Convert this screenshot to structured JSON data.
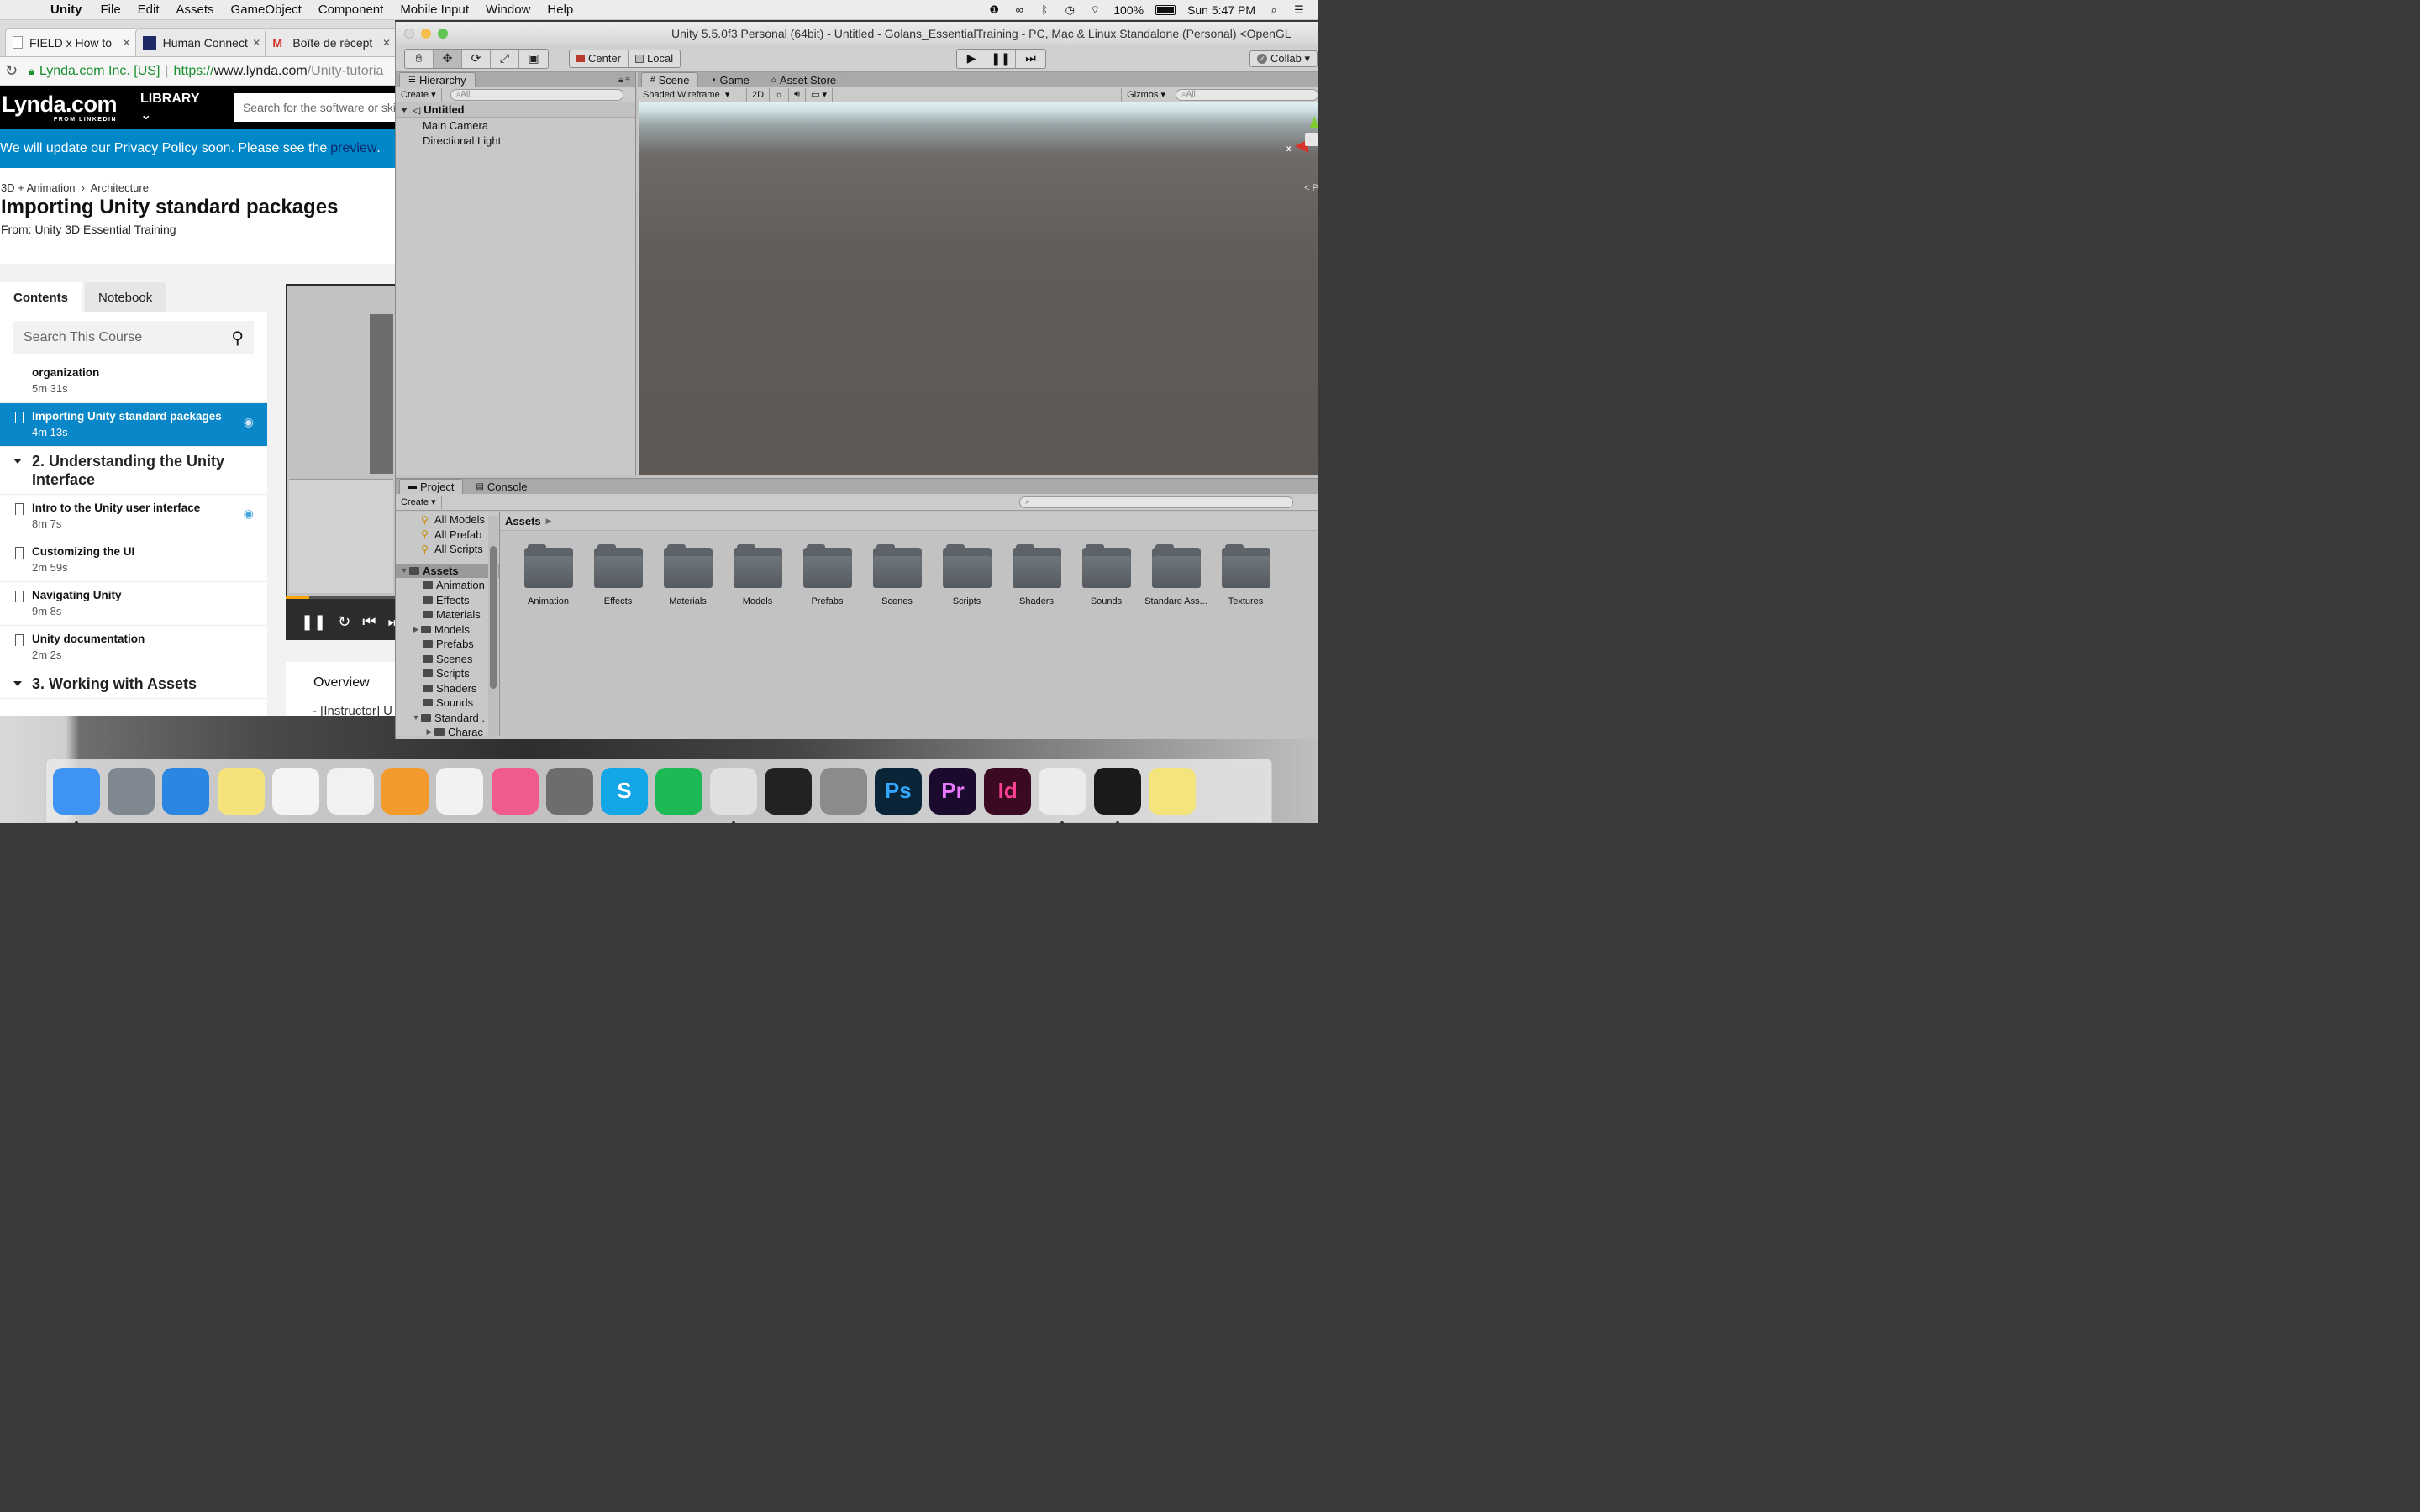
{
  "menubar": {
    "app_name": "Unity",
    "items": [
      "File",
      "Edit",
      "Assets",
      "GameObject",
      "Component",
      "Mobile Input",
      "Window",
      "Help"
    ],
    "battery": "100%",
    "clock": "Sun 5:47 PM",
    "status_icons": [
      "notification-icon",
      "creative-cloud-icon",
      "bluetooth-icon",
      "time-machine-icon",
      "wifi-icon",
      "battery-icon",
      "spotlight-icon",
      "notification-center-icon"
    ]
  },
  "chrome": {
    "tabs": [
      {
        "title": "FIELD x How to"
      },
      {
        "title": "Human Connect"
      },
      {
        "title": "Boîte de récept"
      }
    ],
    "address": {
      "org": "Lynda.com Inc. [US]",
      "scheme": "https://",
      "host": "www.lynda.com",
      "path": "/Unity-tutoria"
    }
  },
  "lynda": {
    "logo": "Lynda.com",
    "logo_sub": "FROM LINKEDIN",
    "library": "LIBRARY",
    "search_placeholder": "Search for the software or skill",
    "privacy_text": "We will update our Privacy Policy soon. Please see the",
    "privacy_link": "preview",
    "privacy_end": ".",
    "breadcrumb_1": "3D + Animation",
    "breadcrumb_2": "Architecture",
    "title": "Importing Unity standard packages",
    "from": "From: Unity 3D Essential Training",
    "tab_contents": "Contents",
    "tab_notebook": "Notebook",
    "course_search": "Search This Course",
    "lessons_top": [
      {
        "title": "organization",
        "duration": "5m 31s"
      },
      {
        "title": "Importing Unity standard packages",
        "duration": "4m 13s",
        "active": true
      }
    ],
    "chapter_2": "2. Understanding the Unity Interface",
    "lessons_ch2": [
      {
        "title": "Intro to the Unity user interface",
        "duration": "8m 7s"
      },
      {
        "title": "Customizing the UI",
        "duration": "2m 59s"
      },
      {
        "title": "Navigating Unity",
        "duration": "9m 8s"
      },
      {
        "title": "Unity documentation",
        "duration": "2m 2s"
      }
    ],
    "chapter_3": "3. Working with Assets",
    "overview_tab": "Overview",
    "transcript_start": "- [Instructor] U"
  },
  "unity": {
    "window_title": "Unity 5.5.0f3 Personal (64bit) - Untitled - Golans_EssentialTraining - PC, Mac & Linux Standalone (Personal) <OpenGL",
    "pivot_center": "Center",
    "pivot_local": "Local",
    "collab": "Collab",
    "hierarchy": {
      "tab": "Hierarchy",
      "create": "Create",
      "search_placeholder": "All",
      "scene_name": "Untitled",
      "items": [
        "Main Camera",
        "Directional Light"
      ]
    },
    "scene": {
      "tab_scene": "Scene",
      "tab_game": "Game",
      "tab_store": "Asset Store",
      "shading": "Shaded Wireframe",
      "mode_2d": "2D",
      "gizmos": "Gizmos",
      "search_placeholder": "All",
      "axis_x": "x",
      "persp": "< P"
    },
    "project": {
      "tab_project": "Project",
      "tab_console": "Console",
      "create": "Create",
      "favorites": [
        "All Models",
        "All Prefab",
        "All Scripts"
      ],
      "assets_root": "Assets",
      "tree": [
        "Animation",
        "Effects",
        "Materials",
        "Models",
        "Prefabs",
        "Scenes",
        "Scripts",
        "Shaders",
        "Sounds",
        "Standard .",
        "Charac"
      ],
      "breadcrumb": "Assets",
      "folders": [
        "Animation",
        "Effects",
        "Materials",
        "Models",
        "Prefabs",
        "Scenes",
        "Scripts",
        "Shaders",
        "Sounds",
        "Standard Ass...",
        "Textures"
      ]
    }
  },
  "dock": {
    "icons": [
      {
        "name": "finder",
        "label": "",
        "color": "#3f93f3"
      },
      {
        "name": "launchpad",
        "label": "",
        "color": "#7f8790"
      },
      {
        "name": "safari",
        "label": "",
        "color": "#2a86e0"
      },
      {
        "name": "notes",
        "label": "",
        "color": "#f6e27a"
      },
      {
        "name": "reminders",
        "label": "",
        "color": "#f4f4f4"
      },
      {
        "name": "photos",
        "label": "",
        "color": "#f1f1f1"
      },
      {
        "name": "pages",
        "label": "",
        "color": "#f39a2d"
      },
      {
        "name": "numbers",
        "label": "",
        "color": "#f2f2f2"
      },
      {
        "name": "itunes",
        "label": "",
        "color": "#f05a8c"
      },
      {
        "name": "system-preferences",
        "label": "",
        "color": "#6d6d6d"
      },
      {
        "name": "skype",
        "label": "S",
        "color": "#12a6e6"
      },
      {
        "name": "spotify",
        "label": "",
        "color": "#1db954"
      },
      {
        "name": "chrome",
        "label": "",
        "color": "#e0e0e0"
      },
      {
        "name": "final-cut",
        "label": "",
        "color": "#222222"
      },
      {
        "name": "rhino",
        "label": "",
        "color": "#8b8b8b"
      },
      {
        "name": "photoshop",
        "label": "Ps",
        "color": "#0b2538"
      },
      {
        "name": "premiere",
        "label": "Pr",
        "color": "#1c0a2e"
      },
      {
        "name": "indesign",
        "label": "Id",
        "color": "#3b0a22"
      },
      {
        "name": "unity",
        "label": "",
        "color": "#ececec"
      },
      {
        "name": "blender-like",
        "label": "",
        "color": "#1a1a1a"
      },
      {
        "name": "stickies",
        "label": "",
        "color": "#f4e47c"
      },
      {
        "name": "trash",
        "label": "",
        "color": "#dcdcdc"
      }
    ]
  }
}
